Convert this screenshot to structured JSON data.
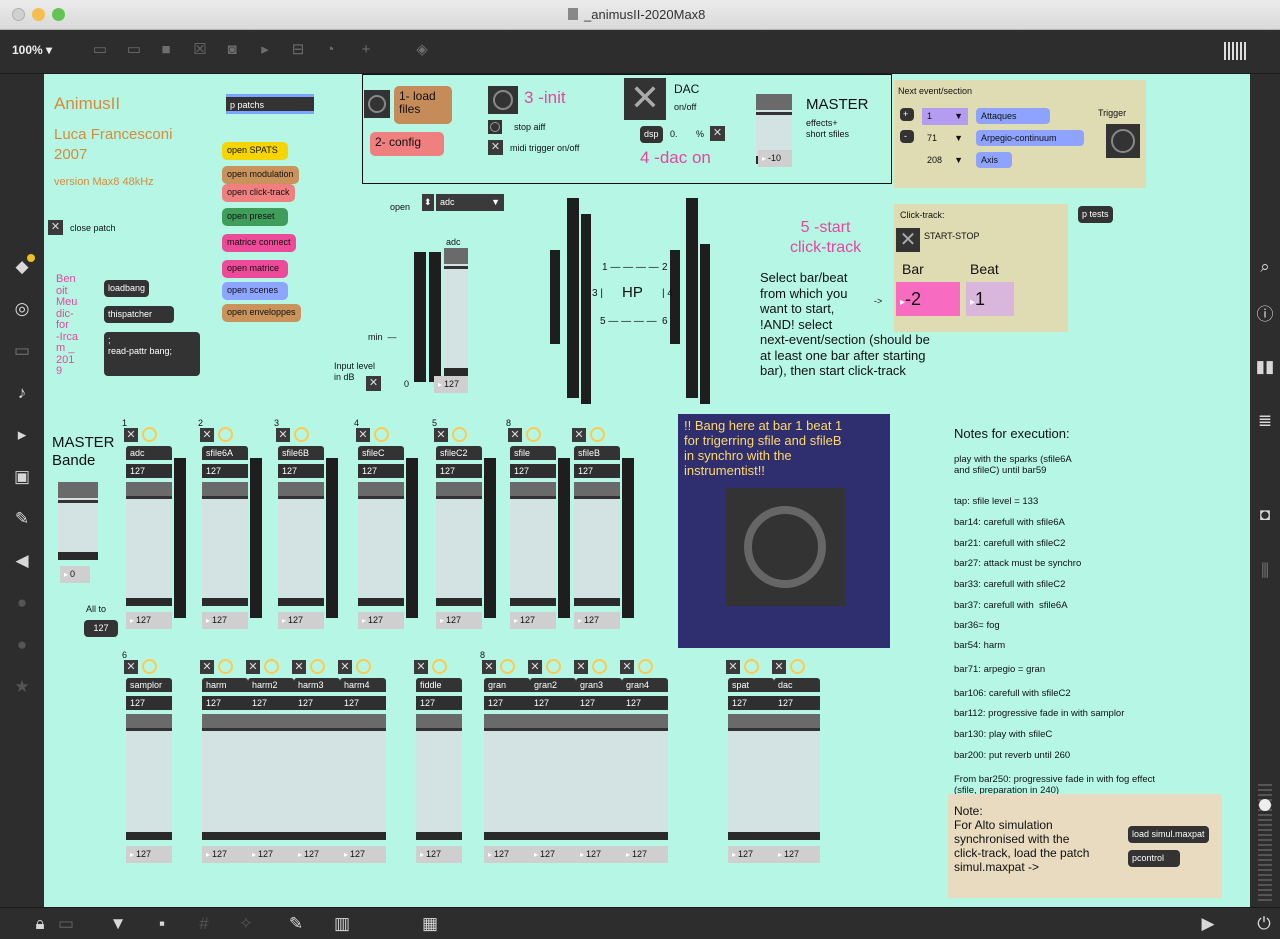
{
  "window": {
    "title": "_animusII-2020Max8"
  },
  "toolbar": {
    "zoom": "100%"
  },
  "header": {
    "title": "AnimusII",
    "author": "Luca Francesconi",
    "year": "2007",
    "version": "version Max8 48kHz",
    "close_patch": "close patch",
    "credit": [
      "Ben",
      "oit",
      "Meu",
      "dic-",
      "for",
      "-Irca",
      "m _",
      "201",
      "9"
    ]
  },
  "objects": {
    "p_patchs": "p patchs",
    "loadbang": "loadbang",
    "thispatcher": "thispatcher",
    "read_pattr": ";\nread-pattr bang;",
    "p_tests": "p tests",
    "load_simul": "load simul.maxpat",
    "pcontrol": "pcontrol"
  },
  "open_buttons": [
    {
      "label": "open SPATS",
      "color": "#f5d400"
    },
    {
      "label": "open modulation",
      "color": "#c9935b"
    },
    {
      "label": "open click-track",
      "color": "#f08080"
    },
    {
      "label": "open preset",
      "color": "#3f9e5c"
    },
    {
      "label": "matrice connect",
      "color": "#ee4a9a"
    },
    {
      "label": "open matrice",
      "color": "#ee4a9a"
    },
    {
      "label": "open scenes",
      "color": "#8ea5ff"
    },
    {
      "label": "open enveloppes",
      "color": "#c9935b"
    }
  ],
  "init_panel": {
    "load_files": "1- load\nfiles",
    "config": "2- config",
    "init": "3 -init",
    "stop_aiff": "stop aiff",
    "midi_trigger": "midi trigger on/off",
    "dac": "DAC",
    "dac_onoff": "on/off",
    "dsp": "dsp",
    "dsp_val": "0.",
    "dsp_pct": "%",
    "dac_on": "4 -dac on",
    "master": "MASTER",
    "master_sub": "effects+\nshort sfiles",
    "master_val": "-10"
  },
  "next_event": {
    "title": "Next event/section",
    "plus": "+",
    "minus": "-",
    "values": [
      "1",
      "71",
      "208"
    ],
    "labels": [
      "Attaques",
      "Arpegio-continuum",
      "Axis"
    ],
    "trigger": "Trigger"
  },
  "adc": {
    "open": "open",
    "select": "adc",
    "label": "adc",
    "min": "min",
    "input_level": "Input level\nin dB",
    "zero": "0",
    "val": "127"
  },
  "hp": {
    "label": "HP",
    "n1": "1",
    "n2": "2",
    "n3": "3",
    "n4": "4",
    "n5": "5",
    "n6": "6"
  },
  "click_track": {
    "start": "5 -start\nclick-track",
    "instruction": "Select bar/beat\nfrom which you\nwant to start,\n!AND! select\nnext-event/section (should be\nat least one bar after starting\nbar), then start click-track",
    "arrow": "->",
    "title": "Click-track:",
    "startstop": "START-STOP",
    "bar_label": "Bar",
    "beat_label": "Beat",
    "bar": "-2",
    "beat": "1"
  },
  "bang_note": "!! Bang here at bar 1 beat 1\nfor trigerring sfile and sfileB\nin synchro with the\ninstrumentist!!",
  "master_bande": {
    "label": "MASTER\nBande",
    "val": "0",
    "all_to": "All to",
    "all_val": "127"
  },
  "row1": [
    {
      "num": "1",
      "name": "adc",
      "val": "127"
    },
    {
      "num": "2",
      "name": "sfile6A",
      "val": "127"
    },
    {
      "num": "3",
      "name": "sfile6B",
      "val": "127"
    },
    {
      "num": "4",
      "name": "sfileC",
      "val": "127"
    },
    {
      "num": "5",
      "name": "sfileC2",
      "val": "127"
    },
    {
      "num": "8",
      "name": "sfile",
      "val": "127"
    },
    {
      "num": "",
      "name": "sfileB",
      "val": "127"
    }
  ],
  "row2": [
    {
      "num": "6",
      "name": "samplor",
      "val": "127"
    },
    {
      "num": "",
      "name": "harm",
      "val": "127"
    },
    {
      "num": "",
      "name": "harm2",
      "val": "127"
    },
    {
      "num": "",
      "name": "harm3",
      "val": "127"
    },
    {
      "num": "",
      "name": "harm4",
      "val": "127"
    },
    {
      "num": "",
      "name": "fiddle",
      "val": "127"
    },
    {
      "num": "8",
      "name": "gran",
      "val": "127"
    },
    {
      "num": "",
      "name": "gran2",
      "val": "127"
    },
    {
      "num": "",
      "name": "gran3",
      "val": "127"
    },
    {
      "num": "",
      "name": "gran4",
      "val": "127"
    },
    {
      "num": "",
      "name": "spat",
      "val": "127"
    },
    {
      "num": "",
      "name": "dac",
      "val": "127"
    }
  ],
  "notes": {
    "title": "Notes for execution:",
    "lines": [
      "play with the sparks (sfile6A\nand sfileC) until bar59",
      "tap: sfile level = 133",
      "bar14: carefull with sfile6A",
      "bar21: carefull with sfileC2",
      "bar27: attack must be synchro",
      "bar33: carefull with sfileC2",
      "bar37: carefull with  sfile6A",
      "bar36= fog",
      "bar54: harm",
      "bar71: arpegio = gran",
      "bar106: carefull with sfileC2",
      "bar112: progressive fade in with samplor",
      "bar130: play with sfileC",
      "bar200: put reverb until 260",
      "From bar250: progressive fade in with fog effect\n(sfile, preparation in 240)"
    ]
  },
  "alto_note": "Note:\nFor Alto simulation\nsynchronised with the\nclick-track, load the patch\nsimul.maxpat ->"
}
